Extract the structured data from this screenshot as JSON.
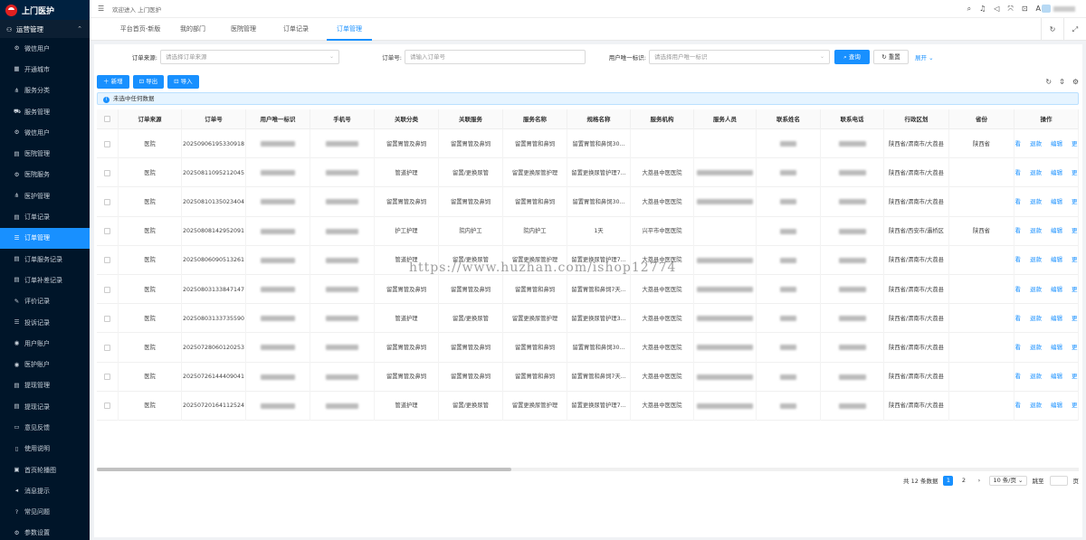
{
  "app": {
    "logo_text": "上门医护"
  },
  "sidebar": {
    "group_label": "运营管理",
    "items": [
      {
        "label": "微信用户",
        "icon": "gear-icon"
      },
      {
        "label": "开通城市",
        "icon": "map-icon"
      },
      {
        "label": "服务分类",
        "icon": "share-icon"
      },
      {
        "label": "服务管理",
        "icon": "cart-icon"
      },
      {
        "label": "微信用户",
        "icon": "gear-icon"
      },
      {
        "label": "医院管理",
        "icon": "table-icon"
      },
      {
        "label": "医院服务",
        "icon": "gear-icon"
      },
      {
        "label": "医护管理",
        "icon": "share-icon"
      },
      {
        "label": "订单记录",
        "icon": "table-icon"
      },
      {
        "label": "订单管理",
        "icon": "list-icon"
      },
      {
        "label": "订单服务记录",
        "icon": "table-icon"
      },
      {
        "label": "订单补差记录",
        "icon": "table-icon"
      },
      {
        "label": "评价记录",
        "icon": "edit-icon"
      },
      {
        "label": "投诉记录",
        "icon": "list-icon"
      },
      {
        "label": "用户账户",
        "icon": "user-icon"
      },
      {
        "label": "医护账户",
        "icon": "user-icon"
      },
      {
        "label": "提现管理",
        "icon": "table-icon"
      },
      {
        "label": "提现记录",
        "icon": "table-icon"
      },
      {
        "label": "意见反馈",
        "icon": "message-icon"
      },
      {
        "label": "使用说明",
        "icon": "doc-icon"
      },
      {
        "label": "首页轮播图",
        "icon": "image-icon"
      },
      {
        "label": "消息提示",
        "icon": "bell-icon"
      },
      {
        "label": "常见问题",
        "icon": "question-icon"
      },
      {
        "label": "参数设置",
        "icon": "gear-icon"
      }
    ]
  },
  "header": {
    "welcome": "欢迎进入 上门医护"
  },
  "tabs": [
    "平台首页-新版",
    "我的部门",
    "医院管理",
    "订单记录",
    "订单管理"
  ],
  "filter": {
    "source_label": "订单来源:",
    "source_placeholder": "请选择订单来源",
    "order_label": "订单号:",
    "order_placeholder": "请输入订单号",
    "user_label": "用户唯一标识:",
    "user_placeholder": "请选择用户唯一标识",
    "query": "查询",
    "reset": "重置",
    "expand": "展开"
  },
  "toolbar": {
    "add": "新增",
    "export": "导出",
    "import": "导入"
  },
  "alert": "未选中任何数据",
  "table": {
    "columns": [
      "订单来源",
      "订单号",
      "用户唯一标识",
      "手机号",
      "关联分类",
      "关联服务",
      "服务名称",
      "规格名称",
      "服务机构",
      "服务人员",
      "联系姓名",
      "联系电话",
      "行政区划",
      "省份",
      "操作"
    ],
    "ops": [
      "查看",
      "退款",
      "编辑",
      "更多"
    ],
    "rows": [
      {
        "src": "医院",
        "no": "20250906195330918",
        "cat": "留置胃管及鼻饲",
        "svc": "留置胃管及鼻饲",
        "name": "留置胃管和鼻饲",
        "spec": "留置胃管和鼻饲30...",
        "org": "",
        "region": "陕西省/渭南市/大荔县",
        "prov": "陕西省"
      },
      {
        "src": "医院",
        "no": "20250811095212045",
        "cat": "管道护理",
        "svc": "留置/更换尿管",
        "name": "留置更换尿管护理",
        "spec": "留置更换尿管护理7...",
        "org": "大荔县中医医院",
        "region": "陕西省/渭南市/大荔县",
        "prov": ""
      },
      {
        "src": "医院",
        "no": "20250810135023404",
        "cat": "留置胃管及鼻饲",
        "svc": "留置胃管及鼻饲",
        "name": "留置胃管和鼻饲",
        "spec": "留置胃管和鼻饲30...",
        "org": "大荔县中医医院",
        "region": "陕西省/渭南市/大荔县",
        "prov": ""
      },
      {
        "src": "医院",
        "no": "20250808142952091",
        "cat": "护工护理",
        "svc": "院内护工",
        "name": "院内护工",
        "spec": "1天",
        "org": "兴平市中医医院",
        "region": "陕西省/西安市/灞桥区",
        "prov": "陕西省"
      },
      {
        "src": "医院",
        "no": "20250806090513261",
        "cat": "管道护理",
        "svc": "留置/更换尿管",
        "name": "留置更换尿管护理",
        "spec": "留置更换尿管护理7...",
        "org": "大荔县中医医院",
        "region": "陕西省/渭南市/大荔县",
        "prov": ""
      },
      {
        "src": "医院",
        "no": "20250803133847147",
        "cat": "留置胃管及鼻饲",
        "svc": "留置胃管及鼻饲",
        "name": "留置胃管和鼻饲",
        "spec": "留置胃管和鼻饲7天...",
        "org": "大荔县中医医院",
        "region": "陕西省/渭南市/大荔县",
        "prov": ""
      },
      {
        "src": "医院",
        "no": "20250803133735590",
        "cat": "管道护理",
        "svc": "留置/更换尿管",
        "name": "留置更换尿管护理",
        "spec": "留置更换尿管护理3...",
        "org": "大荔县中医医院",
        "region": "陕西省/渭南市/大荔县",
        "prov": ""
      },
      {
        "src": "医院",
        "no": "20250728060120253",
        "cat": "留置胃管及鼻饲",
        "svc": "留置胃管及鼻饲",
        "name": "留置胃管和鼻饲",
        "spec": "留置胃管和鼻饲30...",
        "org": "大荔县中医医院",
        "region": "陕西省/渭南市/大荔县",
        "prov": ""
      },
      {
        "src": "医院",
        "no": "20250726144409041",
        "cat": "留置胃管及鼻饲",
        "svc": "留置胃管及鼻饲",
        "name": "留置胃管和鼻饲",
        "spec": "留置胃管和鼻饲7天...",
        "org": "大荔县中医医院",
        "region": "陕西省/渭南市/大荔县",
        "prov": ""
      },
      {
        "src": "医院",
        "no": "20250720164112524",
        "cat": "管道护理",
        "svc": "留置/更换尿管",
        "name": "留置更换尿管护理",
        "spec": "留置更换尿管护理7...",
        "org": "大荔县中医医院",
        "region": "陕西省/渭南市/大荔县",
        "prov": ""
      }
    ]
  },
  "pager": {
    "total": "共 12 条数据",
    "pages": [
      "1",
      "2"
    ],
    "size": "10 条/页",
    "jump": "跳至",
    "page_unit": "页"
  },
  "watermark": "https://www.huzhan.com/ishop12774"
}
